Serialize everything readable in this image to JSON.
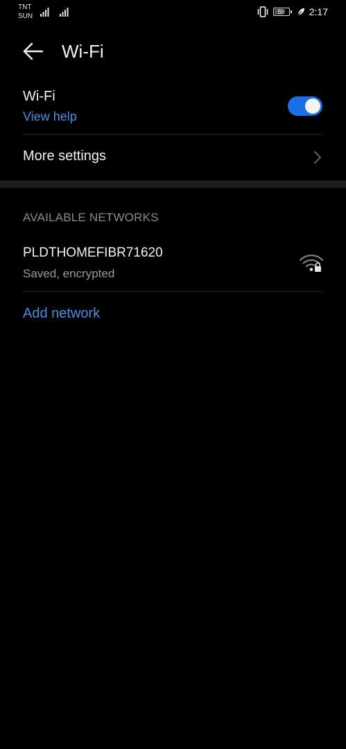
{
  "status_bar": {
    "carrier_1": "TNT",
    "carrier_2": "SUN",
    "battery_level": "59",
    "time": "2:17"
  },
  "header": {
    "title": "Wi-Fi",
    "back_icon": "arrow-left-icon"
  },
  "wifi_setting": {
    "label": "Wi-Fi",
    "help_link": "View help",
    "enabled": true,
    "toggle_color": "#1a6ee6"
  },
  "more_settings": {
    "label": "More settings"
  },
  "available_networks": {
    "header": "AVAILABLE NETWORKS",
    "networks": [
      {
        "name": "PLDTHOMEFIBR71620",
        "status": "Saved, encrypted",
        "icon": "wifi-lock-icon"
      }
    ],
    "add_network_label": "Add network"
  },
  "colors": {
    "background": "#000000",
    "accent": "#4e8ee3",
    "section_header": "#8a8a8a",
    "secondary_text": "#9a9a9a"
  }
}
